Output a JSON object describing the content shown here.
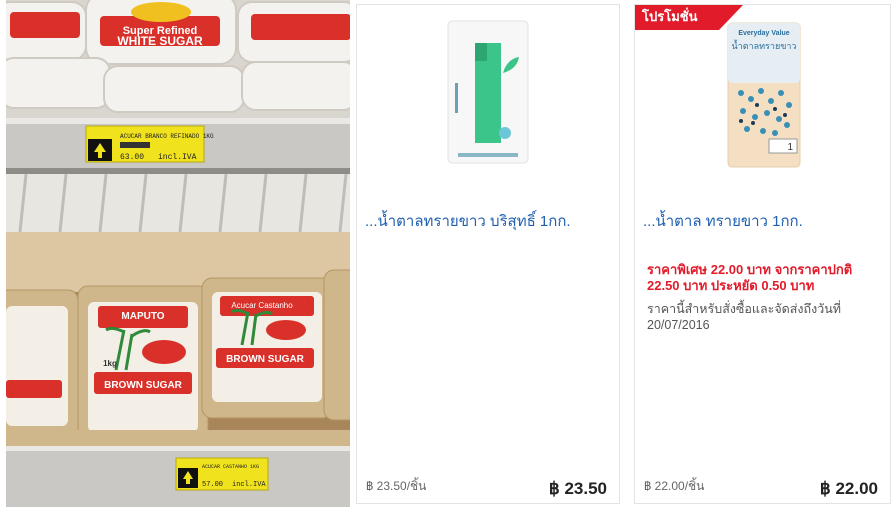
{
  "photo": {
    "shelf_tag_top": {
      "line1": "ACUCAR BRANCO REFINADO 1KG",
      "price": "63.00",
      "tax": "incl.IVA"
    },
    "shelf_tag_bottom": {
      "line1": "ACUCAR CASTANHO 1KG",
      "price": "57.00",
      "tax": "incl.IVA"
    },
    "bag_top_label": "WHITE SUGAR",
    "bag_top_sublabel": "Super Refined",
    "bag_bottom_label": "BROWN SUGAR",
    "bag_bottom_brand": "MAPUTO",
    "bag_bottom_sub": "Acucar Castanho",
    "bag_weight": "1kg"
  },
  "products": [
    {
      "title": "...น้ำตาลทรายขาว บริสุทธิ์ 1กก.",
      "unit_price": "฿ 23.50/ชิ้น",
      "price": "฿ 23.50"
    },
    {
      "ribbon": "โปรโมชั่น",
      "title": "...น้ำตาล ทรายขาว 1กก.",
      "promo_text": "ราคาพิเศษ 22.00 บาท จากราคาปกติ 22.50 บาท ประหยัด 0.50 บาท",
      "note": "ราคานี้สำหรับสั่งซื้อและจัดส่งถึงวันที่ 20/07/2016",
      "package_brand": "Everyday Value",
      "package_title": "น้ำตาลทรายขาว",
      "package_weight": "1",
      "unit_price": "฿ 22.00/ชิ้น",
      "price": "฿ 22.00"
    }
  ],
  "colors": {
    "link": "#1f5fb0",
    "promo": "#e21b2b",
    "ribbon": "#e21b2b"
  }
}
